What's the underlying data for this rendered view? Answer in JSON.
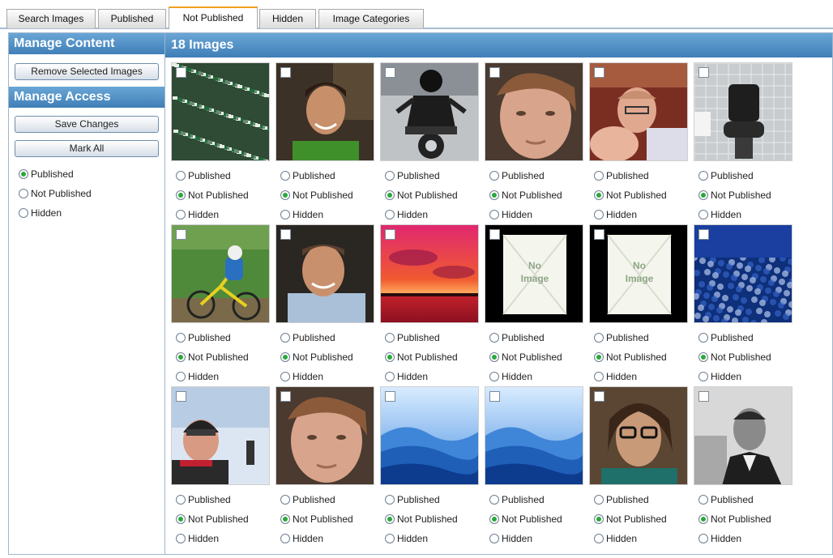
{
  "tabs": [
    {
      "label": "Search Images",
      "active": false
    },
    {
      "label": "Published",
      "active": false
    },
    {
      "label": "Not Published",
      "active": true
    },
    {
      "label": "Hidden",
      "active": false
    },
    {
      "label": "Image Categories",
      "active": false
    }
  ],
  "sidebar": {
    "manage_content_title": "Manage Content",
    "remove_button": "Remove Selected Images",
    "manage_access_title": "Manage Access",
    "save_button": "Save Changes",
    "mark_all_button": "Mark All",
    "access_options": [
      {
        "label": "Published",
        "selected": true
      },
      {
        "label": "Not Published",
        "selected": false
      },
      {
        "label": "Hidden",
        "selected": false
      }
    ]
  },
  "main": {
    "title": "18 Images",
    "option_labels": [
      "Published",
      "Not Published",
      "Hidden"
    ],
    "images": [
      {
        "kind": "crowd",
        "status": "Not Published"
      },
      {
        "kind": "portrait-green",
        "status": "Not Published"
      },
      {
        "kind": "motorcycle",
        "status": "Not Published"
      },
      {
        "kind": "face-closeup",
        "status": "Not Published"
      },
      {
        "kind": "baby-man",
        "status": "Not Published"
      },
      {
        "kind": "bathroom",
        "status": "Not Published"
      },
      {
        "kind": "cyclist",
        "status": "Not Published"
      },
      {
        "kind": "man-smiling",
        "status": "Not Published"
      },
      {
        "kind": "sunset",
        "status": "Not Published"
      },
      {
        "kind": "no-image",
        "status": "Not Published",
        "placeholder_text": [
          "No",
          "Image"
        ]
      },
      {
        "kind": "no-image",
        "status": "Not Published",
        "placeholder_text": [
          "No",
          "Image"
        ]
      },
      {
        "kind": "blue-texture",
        "status": "Not Published"
      },
      {
        "kind": "skier",
        "status": "Not Published"
      },
      {
        "kind": "face-closeup",
        "status": "Not Published"
      },
      {
        "kind": "blue-hills",
        "status": "Not Published"
      },
      {
        "kind": "blue-hills",
        "status": "Not Published"
      },
      {
        "kind": "man-glasses",
        "status": "Not Published"
      },
      {
        "kind": "man-suit-bw",
        "status": "Not Published"
      }
    ]
  }
}
